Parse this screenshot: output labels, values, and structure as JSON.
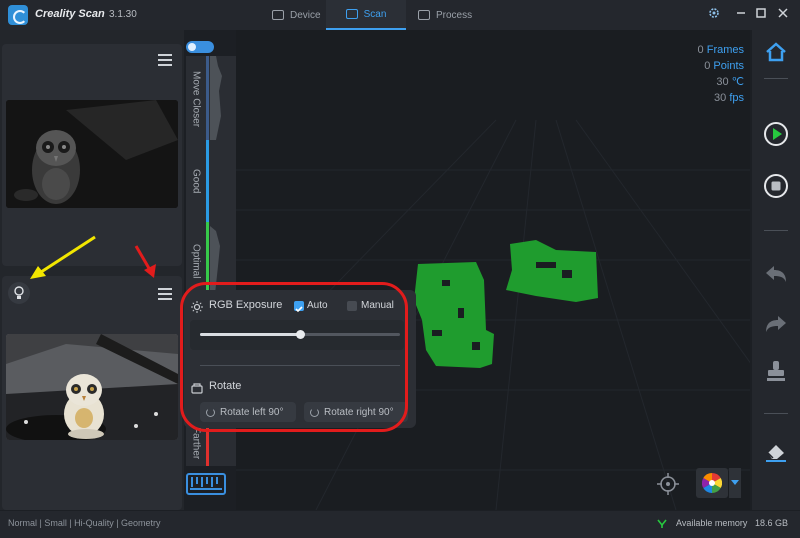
{
  "app": {
    "name": "Creality Scan",
    "version": "3.1.30"
  },
  "tabs": [
    {
      "label": "Device",
      "active": false
    },
    {
      "label": "Scan",
      "active": true
    },
    {
      "label": "Process",
      "active": false
    }
  ],
  "quality": {
    "labels": [
      "Move Closer",
      "Good",
      "Optimal",
      "Farther"
    ]
  },
  "stats": [
    {
      "value": "0",
      "label": "Frames"
    },
    {
      "value": "0",
      "label": "Points"
    },
    {
      "value": "30",
      "label": "℃"
    },
    {
      "value": "30",
      "label": "fps"
    }
  ],
  "popup": {
    "exposure_title": "RGB Exposure",
    "auto_label": "Auto",
    "auto_checked": true,
    "manual_label": "Manual",
    "manual_checked": false,
    "exposure_level": 0.5,
    "rotate_title": "Rotate",
    "rotate_left": "Rotate left 90°",
    "rotate_right": "Rotate right 90°"
  },
  "status": {
    "mode": "Normal | Small | Hi-Quality | Geometry",
    "memory_label": "Available memory",
    "memory_value": "18.6 GB"
  },
  "colors": {
    "accent": "#3ea0f0",
    "scan_green": "#1f9c2e",
    "highlight": "#e21c1c",
    "annotation_yellow": "#f2e600"
  },
  "icons": [
    "gear-icon",
    "minimize-icon",
    "maximize-icon",
    "close-icon",
    "home-icon",
    "play-icon",
    "stop-icon",
    "undo-icon",
    "redo-icon",
    "stamp-icon",
    "eraser-icon",
    "crosshair-icon",
    "color-wheel-icon",
    "bulb-icon",
    "menu-icon"
  ]
}
